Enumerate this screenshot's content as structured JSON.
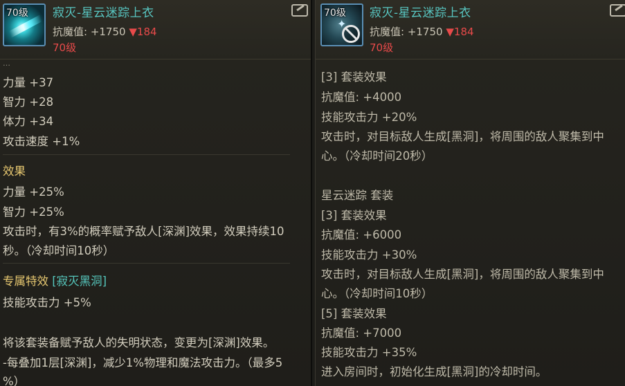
{
  "left": {
    "level_badge": "70级",
    "item_name": "寂灭-星云迷踪上衣",
    "stat_label": "抗魔值: +1750",
    "stat_diff": "▼184",
    "req_level": "70级",
    "faded_text": "…",
    "lines": [
      "力量 +37",
      "智力 +28",
      "体力 +34",
      "攻击速度 +1%"
    ],
    "effect_title": "效果",
    "effect_lines": [
      "力量 +25%",
      "智力 +25%",
      "攻击时，有3%的概率赋予敌人[深渊]效果，效果持续10",
      "秒。（冷却时间10秒）"
    ],
    "exclusive_label": "专属特效",
    "exclusive_name": "[寂灭黑洞]",
    "exclusive_lines": [
      "技能攻击力 +5%",
      "",
      "将该套装备赋予敌人的失明状态，变更为[深渊]效果。",
      "-每叠加1层[深渊]，减少1%物理和魔法攻击力。（最多5",
      "%）"
    ]
  },
  "right": {
    "level_badge": "70级",
    "item_name": "寂灭-星云迷踪上衣",
    "stat_label": "抗魔值: +1750",
    "stat_diff": "▼184",
    "req_level": "70级",
    "lines": [
      "[3] 套装效果",
      "抗魔值: +4000",
      "技能攻击力 +20%",
      "攻击时，对目标敌人生成[黑洞]，将周围的敌人聚集到中",
      "心。（冷却时间20秒）",
      "",
      "星云迷踪  套装",
      "[3] 套装效果",
      "抗魔值: +6000",
      "技能攻击力 +30%",
      "攻击时，对目标敌人生成[黑洞]，将周围的敌人聚集到中",
      "心。（冷却时间10秒）",
      "[5] 套装效果",
      "抗魔值: +7000",
      "技能攻击力 +35%",
      "进入房间时，初始化生成[黑洞]的冷却时间。"
    ]
  }
}
